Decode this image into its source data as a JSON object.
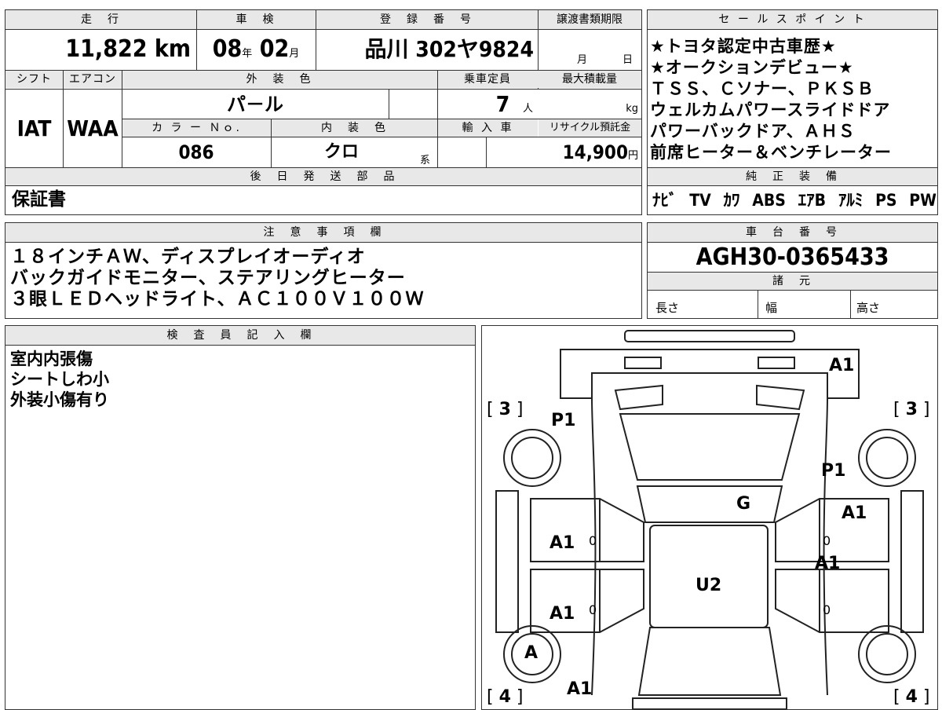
{
  "top_table": {
    "headers": {
      "mileage": "走　行",
      "shaken": "車　検",
      "registration": "登　録　番　号",
      "transfer_deadline": "譲渡書類期限",
      "shift": "シフト",
      "aircon": "エアコン",
      "exterior_color": "外　装　色",
      "capacity": "乗車定員",
      "max_load": "最大積載量",
      "color_no": "カ ラ ー Ｎｏ.",
      "interior_color": "内　装　色",
      "import": "輸 入 車",
      "recycle": "リサイクル預託金",
      "later_parts": "後　日　発　送　部　品"
    },
    "mileage_value": "11,822",
    "mileage_unit": "km",
    "shaken_year": "08",
    "shaken_year_unit": "年",
    "shaken_month": "02",
    "shaken_month_unit": "月",
    "registration_value": "品川 302ヤ9824",
    "transfer_month_unit": "月",
    "transfer_day_unit": "日",
    "shift_value": "IAT",
    "aircon_value": "WAA",
    "exterior_value": "パ－ル",
    "capacity_value": "7",
    "capacity_unit": "人",
    "max_load_unit": "kg",
    "color_no_value": "086",
    "interior_value": "クロ",
    "interior_unit": "系",
    "recycle_value": "14,900",
    "recycle_unit": "円",
    "later_parts_value": "保証書"
  },
  "sales_points": {
    "header": "セ ー ル ス ポ イ ン ト",
    "lines": [
      "★トヨタ認定中古車歴★",
      "★オークションデビュー★",
      "ＴＳＳ、Ｃソナー、ＰＫＳＢ",
      "ウェルカムパワースライドドア",
      "パワーバックドア、ＡＨＳ",
      "前席ヒーター＆ベンチレーター"
    ]
  },
  "genuine_equipment": {
    "header": "純　正　装　備",
    "items": [
      "ﾅﾋﾞ",
      "TV",
      "ｶﾜ",
      "ABS",
      "ｴｱB",
      "ｱﾙﾐ",
      "PS",
      "PW"
    ]
  },
  "notes": {
    "header": "注　意　事　項　欄",
    "lines": [
      "１８インチＡＷ、ディスプレイオーディオ",
      "バックガイドモニター、ステアリングヒーター",
      "３眼ＬＥＤヘッドライト、ＡＣ１００Ｖ１００Ｗ"
    ]
  },
  "chassis": {
    "header": "車　台　番　号",
    "value": "AGH30-0365433",
    "specs_header": "諸　元",
    "length_label": "長さ",
    "width_label": "幅",
    "height_label": "高さ"
  },
  "inspector": {
    "header": "検　査　員　記　入　欄",
    "lines": [
      "室内内張傷",
      "シートしわ小",
      "外装小傷有り"
    ]
  },
  "diagram": {
    "labels": {
      "rear_right": "A1",
      "rear_left_quarter": "P1",
      "rear_right_quarter": "P1",
      "roof": "G",
      "right_rear_door": "A1",
      "left_rear_door": "A1",
      "right_front_door": "A1",
      "hood": "U2",
      "left_front_door": "A1",
      "left_front_wheel": "A",
      "front_left": "A1",
      "tire_rl": "3",
      "tire_rr": "3",
      "tire_fl": "4",
      "tire_fr": "4",
      "zero": "0"
    }
  }
}
